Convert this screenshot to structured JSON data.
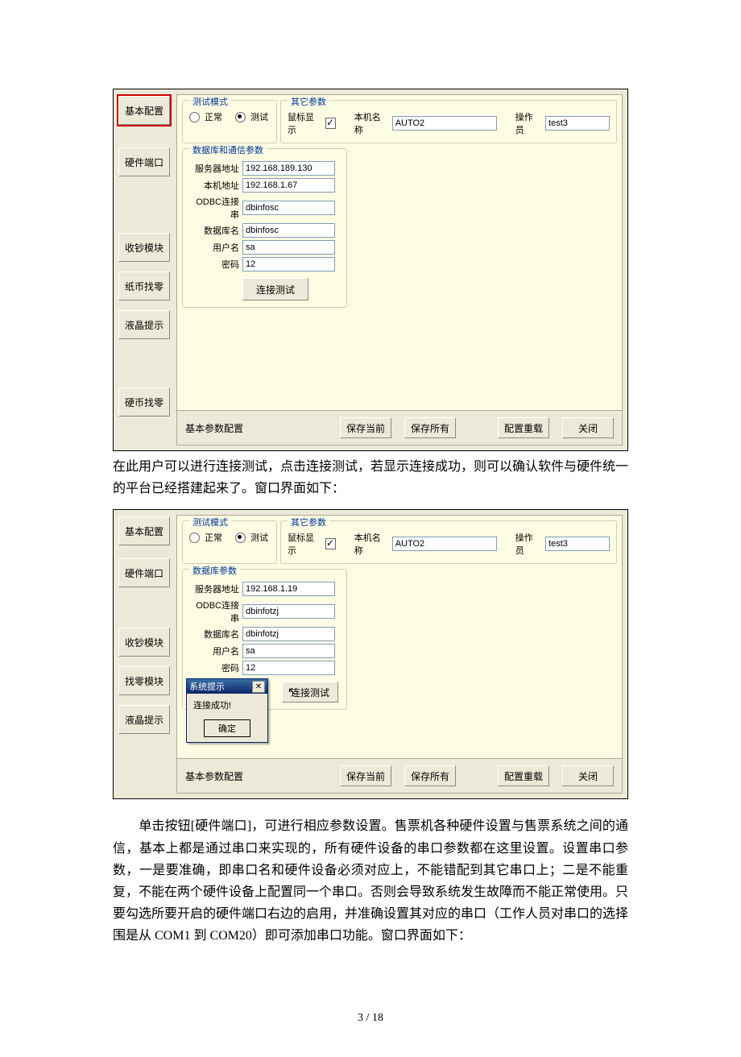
{
  "screenshot1": {
    "sidebar": {
      "items": [
        "基本配置",
        "硬件端口",
        "收钞模块",
        "纸币找零",
        "液晶提示",
        "硬币找零"
      ],
      "active_index": 0
    },
    "test_mode": {
      "legend": "测试模式",
      "radio_normal": "正常",
      "radio_test": "测试",
      "checked": "test"
    },
    "other_params": {
      "legend": "其它参数",
      "mouse_label": "鼠标显示",
      "mouse_checked": true,
      "host_label": "本机名称",
      "host_value": "AUTO2",
      "operator_label": "操作员",
      "operator_value": "test3"
    },
    "db": {
      "legend": "数据库和通信参数",
      "rows": [
        {
          "label": "服务器地址",
          "value": "192.168.189.130"
        },
        {
          "label": "本机地址",
          "value": "192.168.1.67"
        },
        {
          "label": "ODBC连接串",
          "value": "dbinfosc"
        },
        {
          "label": "数据库名",
          "value": "dbinfosc"
        },
        {
          "label": "用户名",
          "value": "sa"
        },
        {
          "label": "密码",
          "value": "12"
        }
      ],
      "test_btn": "连接测试"
    },
    "footer": {
      "title": "基本参数配置",
      "btn_save_current": "保存当前",
      "btn_save_all": "保存所有",
      "btn_reload": "配置重载",
      "btn_close": "关闭"
    }
  },
  "para1": "在此用户可以进行连接测试，点击连接测试，若显示连接成功，则可以确认软件与硬件统一的平台已经搭建起来了。窗口界面如下：",
  "screenshot2": {
    "sidebar": {
      "items": [
        "基本配置",
        "硬件端口",
        "收钞模块",
        "找零模块",
        "液晶提示"
      ]
    },
    "test_mode": {
      "legend": "测试模式",
      "radio_normal": "正常",
      "radio_test": "测试",
      "checked": "test"
    },
    "other_params": {
      "legend": "其它参数",
      "mouse_label": "鼠标显示",
      "mouse_checked": true,
      "host_label": "本机名称",
      "host_value": "AUTO2",
      "operator_label": "操作员",
      "operator_value": "test3"
    },
    "db": {
      "legend": "数据库参数",
      "rows": [
        {
          "label": "服务器地址",
          "value": "192.168.1.19"
        },
        {
          "label": "ODBC连接串",
          "value": "dbinfotzj"
        },
        {
          "label": "数据库名",
          "value": "dbinfotzj"
        },
        {
          "label": "用户名",
          "value": "sa"
        },
        {
          "label": "密码",
          "value": "12"
        }
      ],
      "test_btn": "连接测试"
    },
    "msgbox": {
      "title": "系统提示",
      "body": "连接成功!",
      "ok": "确定"
    },
    "footer": {
      "title": "基本参数配置",
      "btn_save_current": "保存当前",
      "btn_save_all": "保存所有",
      "btn_reload": "配置重载",
      "btn_close": "关闭"
    }
  },
  "para2": "　　单击按钮[硬件端口]，可进行相应参数设置。售票机各种硬件设置与售票系统之间的通信，基本上都是通过串口来实现的，所有硬件设备的串口参数都在这里设置。设置串口参数，一是要准确，即串口名和硬件设备必须对应上，不能错配到其它串口上；二是不能重复，不能在两个硬件设备上配置同一个串口。否则会导致系统发生故障而不能正常使用。只要勾选所要开启的硬件端口右边的启用，并准确设置其对应的串口（工作人员对串口的选择围是从 COM1 到 COM20）即可添加串口功能。窗口界面如下：",
  "page_number": "3 / 18"
}
